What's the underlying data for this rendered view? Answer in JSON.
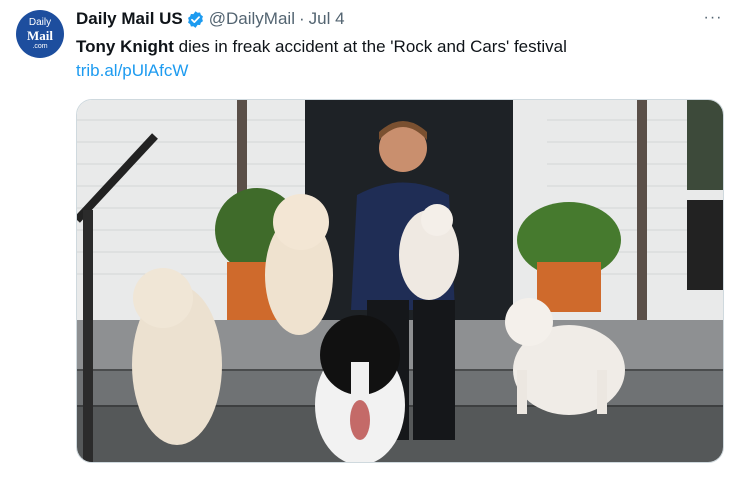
{
  "tweet": {
    "avatar": {
      "line1": "Daily",
      "line2": "Mail",
      "line3": ".com"
    },
    "author_name": "Daily Mail US",
    "handle": "@DailyMail",
    "separator": "·",
    "date": "Jul 4",
    "more_label": "···",
    "text_bold": "Tony Knight",
    "text_rest": " dies in freak accident at the 'Rock and Cars' festival",
    "link": "trib.al/pUlAfcW",
    "media_icon": "photo-image",
    "colors": {
      "accent": "#1d9bf0",
      "secondary_text": "#536471",
      "avatar_bg": "#1d4e9e"
    }
  }
}
